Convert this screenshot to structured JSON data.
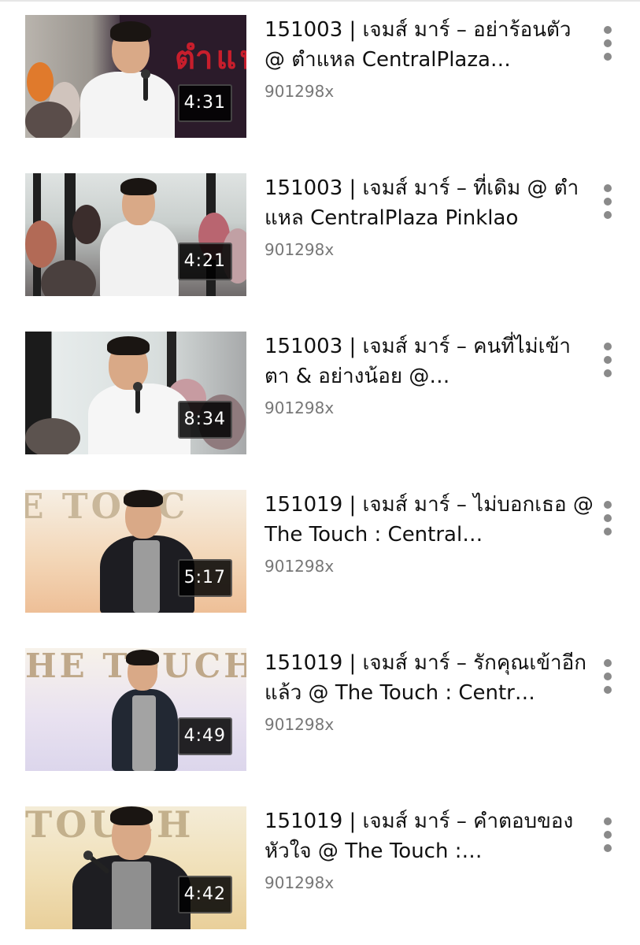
{
  "videos": [
    {
      "title": "151003 | เจมส์ มาร์ – อย่าร้อนตัว @ ตำแหล CentralPlaza…",
      "views": "901298x",
      "duration": "4:31",
      "menu_icon": "more-vert-icon",
      "theme": "mall-dark"
    },
    {
      "title": "151003 | เจมส์ มาร์ – ที่เดิม @ ตำแหล CentralPlaza Pinklao",
      "views": "901298x",
      "duration": "4:21",
      "menu_icon": "more-vert-icon",
      "theme": "mall-crowd"
    },
    {
      "title": "151003 | เจมส์ มาร์ – คนที่ไม่เข้าตา & อย่างน้อย @…",
      "views": "901298x",
      "duration": "8:34",
      "menu_icon": "more-vert-icon",
      "theme": "mall-crowd-light"
    },
    {
      "title": "151019 | เจมส์ มาร์ – ไม่บอกเธอ @ The Touch : Central…",
      "views": "901298x",
      "duration": "5:17",
      "menu_icon": "more-vert-icon",
      "theme": "touch-stage"
    },
    {
      "title": "151019 | เจมส์ มาร์ – รักคุณเข้าอีกแล้ว @ The Touch : Centr…",
      "views": "901298x",
      "duration": "4:49",
      "menu_icon": "more-vert-icon",
      "theme": "touch-stage-wide"
    },
    {
      "title": "151019 | เจมส์ มาร์ – คำตอบของหัวใจ @ The Touch :…",
      "views": "901298x",
      "duration": "4:42",
      "menu_icon": "more-vert-icon",
      "theme": "touch-stage-close"
    }
  ],
  "colors": {
    "title_text": "#111111",
    "views_text": "#777777",
    "menu_dots": "#8a8a8a",
    "duration_bg": "#000000",
    "background": "#ffffff"
  }
}
